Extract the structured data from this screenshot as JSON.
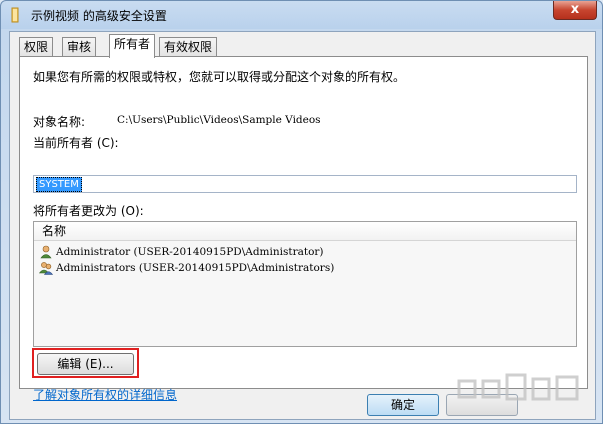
{
  "window": {
    "title": "示例视频 的高级安全设置",
    "close_glyph": "x",
    "folder_color": "#e8b84a"
  },
  "tabs": [
    {
      "label": "权限",
      "active": false
    },
    {
      "label": "审核",
      "active": false
    },
    {
      "label": "所有者",
      "active": true
    },
    {
      "label": "有效权限",
      "active": false
    }
  ],
  "owner_tab": {
    "intro_text": "如果您有所需的权限或特权，您就可以取得或分配这个对象的所有权。",
    "object_name_label": "对象名称:",
    "object_name_value": "C:\\Users\\Public\\Videos\\Sample Videos",
    "current_owner_label": "当前所有者 (C):",
    "current_owner_value": "SYSTEM",
    "change_owner_label": "将所有者更改为 (O):",
    "list_header": "名称",
    "owners": [
      {
        "name": "Administrator (USER-20140915PD\\Administrator)",
        "icon": "user-icon"
      },
      {
        "name": "Administrators (USER-20140915PD\\Administrators)",
        "icon": "group-icon"
      }
    ],
    "edit_button": "编辑 (E)...",
    "learn_more_link": "了解对象所有权的详细信息"
  },
  "footer": {
    "ok_button": "确定"
  },
  "colors": {
    "accent": "#3399ff",
    "link": "#0066cc",
    "highlight_box": "#e02020"
  }
}
